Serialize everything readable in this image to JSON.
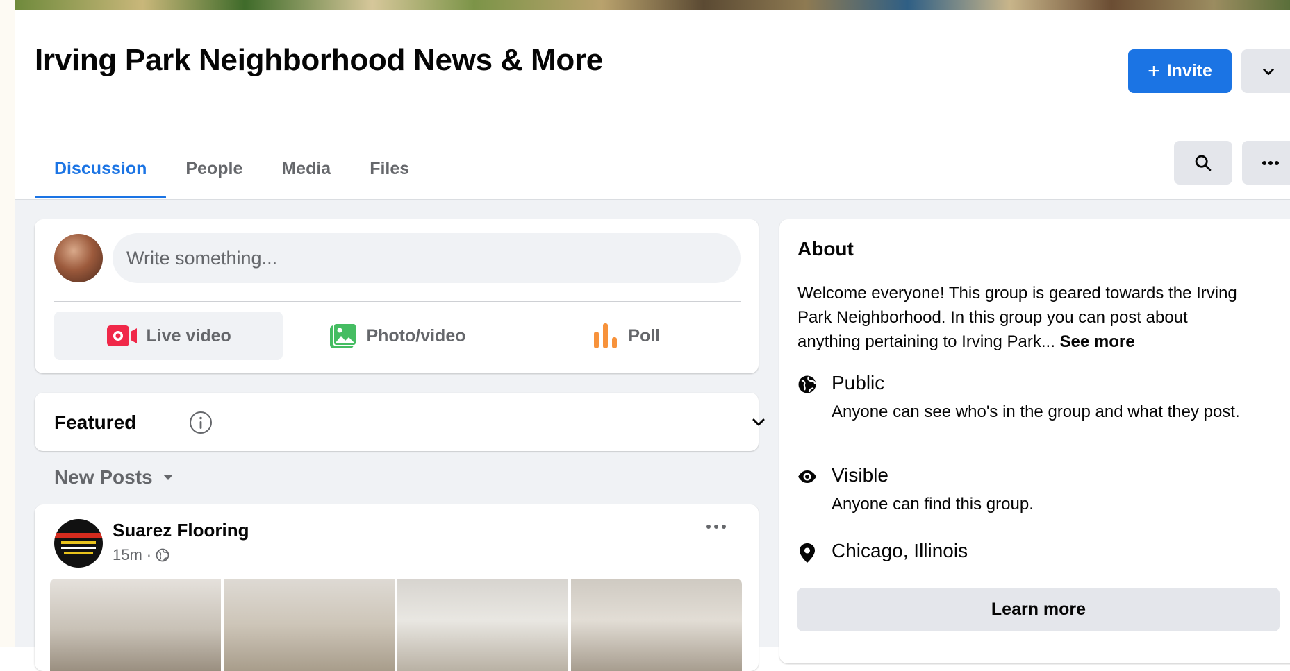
{
  "group": {
    "title": "Irving Park Neighborhood News & More"
  },
  "header": {
    "invite_label": "Invite"
  },
  "tabs": [
    {
      "label": "Discussion",
      "active": true
    },
    {
      "label": "People",
      "active": false
    },
    {
      "label": "Media",
      "active": false
    },
    {
      "label": "Files",
      "active": false
    }
  ],
  "composer": {
    "placeholder": "Write something...",
    "actions": [
      {
        "label": "Live video",
        "icon": "live-video-icon",
        "color": "#f02849"
      },
      {
        "label": "Photo/video",
        "icon": "photo-icon",
        "color": "#45bd62"
      },
      {
        "label": "Poll",
        "icon": "poll-icon",
        "color": "#f7923b"
      }
    ]
  },
  "featured": {
    "label": "Featured"
  },
  "feed": {
    "sort_label": "New Posts"
  },
  "post": {
    "author": "Suarez Flooring",
    "time": "15m",
    "separator": "·"
  },
  "about": {
    "title": "About",
    "description": "Welcome everyone! This group is geared towards the Irving Park Neighborhood. In this group you can post about anything pertaining to Irving Park... ",
    "see_more": "See more",
    "privacy": {
      "label": "Public",
      "detail": "Anyone can see who's in the group and what they post."
    },
    "visibility": {
      "label": "Visible",
      "detail": "Anyone can find this group."
    },
    "location": {
      "label": "Chicago, Illinois"
    },
    "learn_more_label": "Learn more"
  },
  "colors": {
    "accent": "#1b74e4",
    "background": "#f0f2f5",
    "secondary_text": "#65676b"
  }
}
